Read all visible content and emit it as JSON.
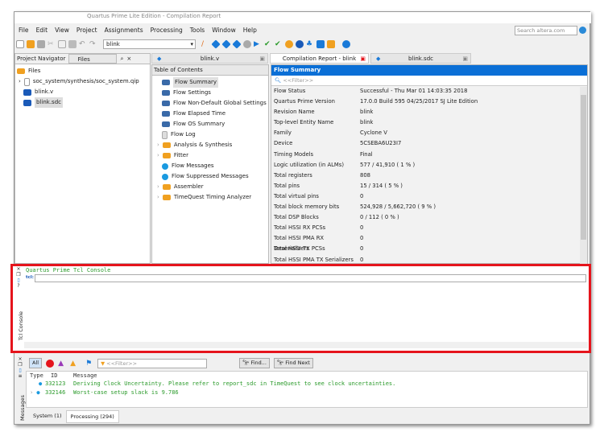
{
  "window": {
    "title": "Quartus Prime Lite Edition - Compilation Report"
  },
  "menu": [
    "File",
    "Edit",
    "View",
    "Project",
    "Assignments",
    "Processing",
    "Tools",
    "Window",
    "Help"
  ],
  "search": {
    "placeholder": "Search altera.com"
  },
  "toolbar": {
    "revision": "blink"
  },
  "navigator": {
    "label": "Project Navigator",
    "view": "Files",
    "root": "Files",
    "items": [
      "soc_system/synthesis/soc_system.qip",
      "blink.v",
      "blink.sdc"
    ]
  },
  "tabs": [
    "blink.v",
    "Compilation Report - blink",
    "blink.sdc"
  ],
  "toc": {
    "title": "Table of Contents",
    "items": [
      "Flow Summary",
      "Flow Settings",
      "Flow Non-Default Global Settings",
      "Flow Elapsed Time",
      "Flow OS Summary",
      "Flow Log",
      "Analysis & Synthesis",
      "Fitter",
      "Flow Messages",
      "Flow Suppressed Messages",
      "Assembler",
      "TimeQuest Timing Analyzer"
    ]
  },
  "report": {
    "title": "Flow Summary",
    "filter": "<<Filter>>",
    "rows": [
      [
        "Flow Status",
        "Successful - Thu Mar 01 14:03:35 2018"
      ],
      [
        "Quartus Prime Version",
        "17.0.0 Build 595 04/25/2017 SJ Lite Edition"
      ],
      [
        "Revision Name",
        "blink"
      ],
      [
        "Top-level Entity Name",
        "blink"
      ],
      [
        "Family",
        "Cyclone V"
      ],
      [
        "Device",
        "5CSEBA6U23I7"
      ],
      [
        "Timing Models",
        "Final"
      ],
      [
        "Logic utilization (in ALMs)",
        "577 / 41,910 ( 1 % )"
      ],
      [
        "Total registers",
        "808"
      ],
      [
        "Total pins",
        "15 / 314 ( 5 % )"
      ],
      [
        "Total virtual pins",
        "0"
      ],
      [
        "Total block memory bits",
        "524,928 / 5,662,720 ( 9 % )"
      ],
      [
        "Total DSP Blocks",
        "0 / 112 ( 0 % )"
      ],
      [
        "Total HSSI RX PCSs",
        "0"
      ],
      [
        "Total HSSI PMA RX Deserializers",
        "0"
      ],
      [
        "Total HSSI TX PCSs",
        "0"
      ],
      [
        "Total HSSI PMA TX Serializers",
        "0"
      ]
    ]
  },
  "tcl": {
    "title": "Quartus Prime Tcl Console",
    "prompt": "tcl:",
    "side_label": "Tcl Console"
  },
  "messages": {
    "side_label": "Messages",
    "all": "All",
    "filter": "<<Filter>>",
    "find": "Find...",
    "find_next": "Find Next",
    "columns": [
      "Type",
      "ID",
      "Message"
    ],
    "rows": [
      [
        "332123",
        "Deriving Clock Uncertainty. Please refer to report_sdc in TimeQuest to see clock uncertainties."
      ],
      [
        "332146",
        "Worst-case setup slack is 9.786"
      ]
    ],
    "tabs": [
      "System (1)",
      "Processing (294)"
    ]
  },
  "colors": {
    "accent": "#0a6fd6",
    "highlight": "#e5141c",
    "console_text": "#2a9a2a"
  }
}
